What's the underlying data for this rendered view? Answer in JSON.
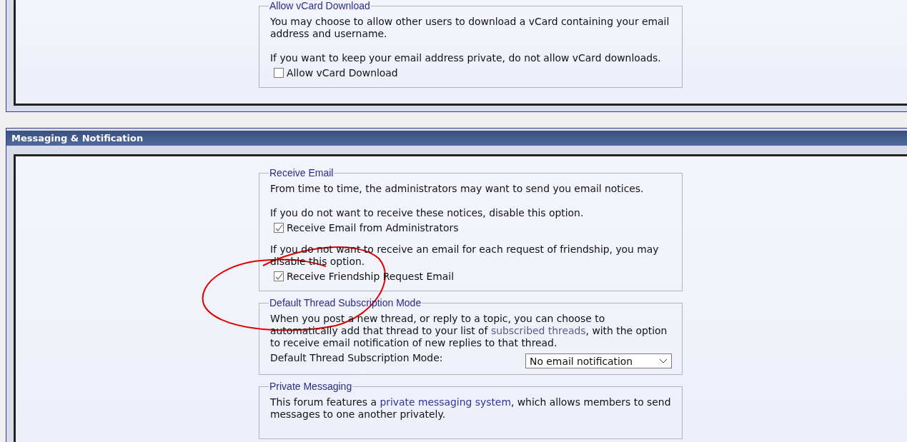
{
  "profile_panel": {
    "fieldsets": [
      {
        "legend": "Allow vCard Download",
        "items": [
          {
            "kind": "text",
            "parts": [
              {
                "text": "You may choose to allow other users to download a vCard containing your email address and username."
              }
            ]
          },
          {
            "kind": "text",
            "parts": [
              {
                "text": "If you want to keep your email address private, do not allow vCard downloads."
              }
            ]
          },
          {
            "kind": "checkbox",
            "label": "Allow vCard Download",
            "checked": false
          }
        ]
      }
    ]
  },
  "section": {
    "title": "Messaging & Notification",
    "fieldsets": [
      {
        "legend": "Receive Email",
        "items": [
          {
            "kind": "text",
            "parts": [
              {
                "text": "From time to time, the administrators may want to send you email notices."
              }
            ]
          },
          {
            "kind": "text",
            "parts": [
              {
                "text": "If you do not want to receive these notices, disable this option."
              }
            ]
          },
          {
            "kind": "checkbox",
            "label": "Receive Email from Administrators",
            "checked": true
          },
          {
            "kind": "text",
            "parts": [
              {
                "text": "If you do not want to receive an email for each request of friendship, you may disable this option."
              }
            ]
          },
          {
            "kind": "checkbox",
            "label": "Receive Friendship Request Email",
            "checked": true
          }
        ]
      },
      {
        "legend": "Default Thread Subscription Mode",
        "items": [
          {
            "kind": "text",
            "parts": [
              {
                "text": "When you post a new thread, or reply to a topic, you can choose to automatically add that thread to your list of "
              },
              {
                "text": "subscribed threads",
                "link": true,
                "visited": true
              },
              {
                "text": ", with the option to receive email notification of new replies to that thread."
              }
            ]
          },
          {
            "kind": "select",
            "label": "Default Thread Subscription Mode:",
            "value": "No email notification"
          }
        ]
      },
      {
        "legend": "Private Messaging",
        "items": [
          {
            "kind": "text",
            "parts": [
              {
                "text": "This forum features a "
              },
              {
                "text": "private messaging system",
                "link": true,
                "visited": false
              },
              {
                "text": ", which allows members to send messages to one another privately."
              }
            ]
          }
        ]
      }
    ]
  }
}
